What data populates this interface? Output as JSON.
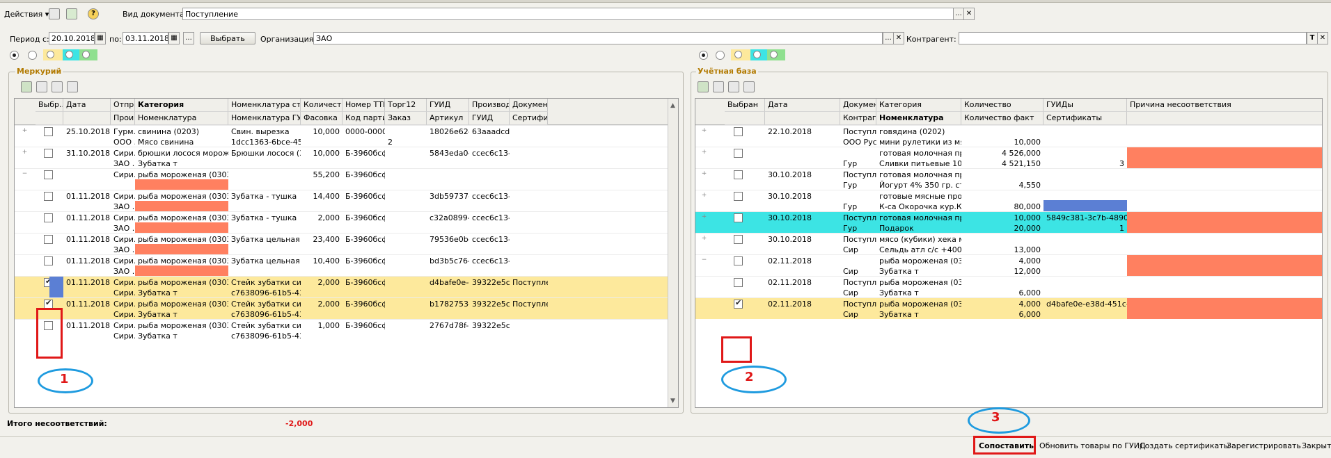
{
  "toolbar": {
    "actions_label": "Действия",
    "doc_type_label": "Вид документа:",
    "doc_type_value": "Поступление",
    "dots": "...",
    "clear": "✕",
    "help": "?"
  },
  "filter": {
    "period_from_label": "Период с:",
    "period_from": "20.10.2018",
    "period_to_label": "по:",
    "period_to": "03.11.2018",
    "dots": "...",
    "select_button": "Выбрать",
    "org_label": "Организация:",
    "org_value": "ЗАО",
    "contractor_label": "Контрагент:",
    "contractor_value": "",
    "t_button": "T"
  },
  "colors": {
    "salmon": "#FF8060",
    "yellow_row": "#FDE99C",
    "cyan_row": "#3CE4E4",
    "blue_cell": "#5B7FD4",
    "accent": "#B27A00",
    "red": "#E01818",
    "ellipse": "#1F9BDF"
  },
  "mercury": {
    "title": "Меркурий",
    "headers_top": [
      "Выбр...",
      "Дата",
      "Отпр...",
      "Категория",
      "Номенклатура строкой",
      "Количество",
      "Номер ТТН",
      "Торг12",
      "ГУИД",
      "Производи...",
      "Документ"
    ],
    "headers_bottom": [
      "",
      "",
      "Прои...",
      "Номенклатура",
      "Номенклатура ГУИД",
      "Фасовка",
      "Код партии",
      "Заказ",
      "Артикул",
      "ГУИД",
      "Сертификат"
    ],
    "rows": [
      {
        "exp": "+",
        "checked": false,
        "date": "25.10.2018",
        "sender": "Гурм...",
        "category": "свинина (0203)",
        "nom_str": "Свин. вырезка",
        "qty": "10,000",
        "ttn": "0000-000067",
        "torg": "",
        "guid": "18026e62-...",
        "prod": "63aaadcd-...",
        "doc": "",
        "sender2": "ООО ...",
        "nom": "Мясо свинина",
        "nom_guid": "1dcc1363-6bce-45d1-...",
        "pack": "",
        "batch": "",
        "order": "2",
        "article": "",
        "prod_guid": "",
        "cert": ""
      },
      {
        "exp": "+",
        "checked": false,
        "date": "31.10.2018",
        "sender": "Сири...",
        "category": "брюшки лосося мороженые ...",
        "nom_str": "Брюшки лосося (3+) ...",
        "qty": "10,000",
        "ttn": "Б-3960бсф...",
        "torg": "",
        "guid": "5843eda0-...",
        "prod": "ccec6c13-...",
        "doc": "",
        "sender2": "ЗАО ...",
        "nom": "Зубатка т",
        "nom_guid": "",
        "pack": "",
        "batch": "",
        "order": "",
        "article": "",
        "prod_guid": "",
        "cert": ""
      },
      {
        "exp": "−",
        "checked": false,
        "date": "",
        "sender": "Сири...",
        "category": "рыба мороженая (0303)",
        "nom_str": "",
        "qty": "55,200",
        "ttn": "Б-3960бсф...",
        "torg": "",
        "guid": "",
        "prod": "",
        "doc": "",
        "sender2": "",
        "nom": "",
        "nom_guid": "",
        "pack": "",
        "batch": "",
        "order": "",
        "article": "",
        "prod_guid": "",
        "cert": ""
      },
      {
        "exp": "",
        "checked": false,
        "date": "01.11.2018",
        "sender": "Сири...",
        "category": "рыба мороженая (0303)",
        "nom_str": "Зубатка - тушка",
        "qty": "14,400",
        "ttn": "Б-3960бсф...",
        "torg": "",
        "guid": "3db59737-...",
        "prod": "ccec6c13-...",
        "doc": "",
        "sender2": "ЗАО ...",
        "nom": "",
        "nom_guid": "",
        "pack": "",
        "batch": "",
        "order": "",
        "article": "",
        "prod_guid": "",
        "cert": ""
      },
      {
        "exp": "",
        "checked": false,
        "date": "01.11.2018",
        "sender": "Сири...",
        "category": "рыба мороженая (0303)",
        "nom_str": "Зубатка - тушка",
        "qty": "2,000",
        "ttn": "Б-3960бсф...",
        "torg": "",
        "guid": "c32a0899-...",
        "prod": "ccec6c13-...",
        "doc": "",
        "sender2": "ЗАО ...",
        "nom": "",
        "nom_guid": "",
        "pack": "",
        "batch": "",
        "order": "",
        "article": "",
        "prod_guid": "",
        "cert": ""
      },
      {
        "exp": "",
        "checked": false,
        "date": "01.11.2018",
        "sender": "Сири...",
        "category": "рыба мороженая (0303)",
        "nom_str": "Зубатка цельная",
        "qty": "23,400",
        "ttn": "Б-3960бсф...",
        "torg": "",
        "guid": "79536e0b-...",
        "prod": "ccec6c13-...",
        "doc": "",
        "sender2": "ЗАО ...",
        "nom": "",
        "nom_guid": "",
        "pack": "",
        "batch": "",
        "order": "",
        "article": "",
        "prod_guid": "",
        "cert": ""
      },
      {
        "exp": "",
        "checked": false,
        "date": "01.11.2018",
        "sender": "Сири...",
        "category": "рыба мороженая (0303)",
        "nom_str": "Зубатка цельная",
        "qty": "10,400",
        "ttn": "Б-3960бсф...",
        "torg": "",
        "guid": "bd3b5c76-...",
        "prod": "ccec6c13-...",
        "doc": "",
        "sender2": "ЗАО ...",
        "nom": "",
        "nom_guid": "",
        "pack": "",
        "batch": "",
        "order": "",
        "article": "",
        "prod_guid": "",
        "cert": ""
      },
      {
        "exp": "",
        "checked": true,
        "date": "01.11.2018",
        "sender": "Сири...",
        "category": "рыба мороженая (0303)",
        "nom_str": "Стейк зубатки синей ...",
        "qty": "2,000",
        "ttn": "Б-3960бсф...",
        "torg": "",
        "guid": "d4bafe0e-e...",
        "prod": "39322e5c-...",
        "doc": "Поступле...",
        "sender2": "Сири...",
        "nom": "Зубатка т",
        "nom_guid": "c7638096-61b5-4309-...",
        "pack": "",
        "batch": "",
        "order": "",
        "article": "",
        "prod_guid": "",
        "cert": ""
      },
      {
        "exp": "",
        "checked": true,
        "date": "01.11.2018",
        "sender": "Сири...",
        "category": "рыба мороженая (0303)",
        "nom_str": "Стейк зубатки синей ...",
        "qty": "2,000",
        "ttn": "Б-3960бсф...",
        "torg": "",
        "guid": "b1782753-...",
        "prod": "39322e5c-...",
        "doc": "Поступле...",
        "sender2": "Сири...",
        "nom": "Зубатка т",
        "nom_guid": "c7638096-61b5-4309-...",
        "pack": "",
        "batch": "",
        "order": "",
        "article": "",
        "prod_guid": "",
        "cert": ""
      },
      {
        "exp": "",
        "checked": false,
        "date": "01.11.2018",
        "sender": "Сири...",
        "category": "рыба мороженая (0303)",
        "nom_str": "Стейк зубатки синей ...",
        "qty": "1,000",
        "ttn": "Б-3960бсф...",
        "torg": "",
        "guid": "2767d78f-0...",
        "prod": "39322e5c-...",
        "doc": "",
        "sender2": "Сири...",
        "nom": "Зубатка т",
        "nom_guid": "c7638096-61b5-4309-...",
        "pack": "",
        "batch": "",
        "order": "",
        "article": "",
        "prod_guid": "",
        "cert": ""
      }
    ]
  },
  "account": {
    "title": "Учётная база",
    "headers_top": [
      "Выбран",
      "Дата",
      "Документ",
      "Категория",
      "Количество",
      "ГУИДы",
      "Причина несоответствия"
    ],
    "headers_bottom": [
      "",
      "",
      "Контрагент",
      "Номенклатура",
      "Количество факт",
      "Сертификаты",
      ""
    ],
    "rows": [
      {
        "exp": "+",
        "checked": false,
        "date": "22.10.2018",
        "doc": "Поступле...",
        "category": "говядина (0202)",
        "qty": "",
        "guids": "",
        "contractor": "ООО Рус...",
        "nom": "мини рулетики из мяса",
        "qty_fact": "10,000",
        "certs": ""
      },
      {
        "exp": "+",
        "checked": false,
        "date": "",
        "doc": "",
        "category": "готовая молочная проду...",
        "qty": "4 526,000",
        "guids": "",
        "contractor": "Гур",
        "nom": "Сливки питьевые 10% 0,...",
        "qty_fact": "4 521,150",
        "certs": "3"
      },
      {
        "exp": "+",
        "checked": false,
        "date": "30.10.2018",
        "doc": "Поступле...",
        "category": "готовая молочная проду...",
        "qty": "",
        "guids": "",
        "contractor": "Гур",
        "nom": "Йогурт 4% 350 гр. стака...",
        "qty_fact": "4,550",
        "certs": ""
      },
      {
        "exp": "+",
        "checked": false,
        "date": "30.10.2018",
        "doc": "",
        "category": "готовые мясные продукт...",
        "qty": "",
        "guids": "",
        "contractor": "Гур",
        "nom": "К-са Окорочка кур.КУПЕ...",
        "qty_fact": "80,000",
        "certs": ""
      },
      {
        "exp": "+",
        "checked": false,
        "date": "30.10.2018",
        "doc": "Поступле...",
        "category": "готовая молочная проду...",
        "qty": "10,000",
        "guids": "5849c381-3c7b-4890-9617...",
        "contractor": "Гур",
        "nom": "Подарок",
        "qty_fact": "20,000",
        "certs": "1"
      },
      {
        "exp": "+",
        "checked": false,
        "date": "30.10.2018",
        "doc": "Поступле...",
        "category": "мясо (кубики) хека моро...",
        "qty": "",
        "guids": "",
        "contractor": "Сир",
        "nom": "Сельдь атл с/с +400",
        "qty_fact": "13,000",
        "certs": ""
      },
      {
        "exp": "−",
        "checked": false,
        "date": "02.11.2018",
        "doc": "",
        "category": "рыба мороженая (0303)",
        "qty": "4,000",
        "guids": "",
        "contractor": "Сир",
        "nom": "Зубатка т",
        "qty_fact": "12,000",
        "certs": ""
      },
      {
        "exp": "",
        "checked": false,
        "date": "02.11.2018",
        "doc": "Поступле...",
        "category": "рыба мороженая (0303)",
        "qty": "",
        "guids": "",
        "contractor": "Сир",
        "nom": "Зубатка т",
        "qty_fact": "6,000",
        "certs": ""
      },
      {
        "exp": "",
        "checked": true,
        "date": "02.11.2018",
        "doc": "Поступле...",
        "category": "рыба мороженая (0303)",
        "qty": "4,000",
        "guids": "d4bafe0e-e38d-451c-bfea-...",
        "contractor": "Сир",
        "nom": "Зубатка т",
        "qty_fact": "6,000",
        "certs": ""
      }
    ]
  },
  "total": {
    "label": "Итого несоответствий:",
    "value": "-2,000"
  },
  "bottom": {
    "match": "Сопоставить",
    "update": "Обновить товары по ГУИД",
    "create_certs": "Создать сертификаты",
    "register": "Зарегистрировать",
    "close": "Закрыть"
  },
  "annotations": [
    "1",
    "2",
    "3"
  ]
}
